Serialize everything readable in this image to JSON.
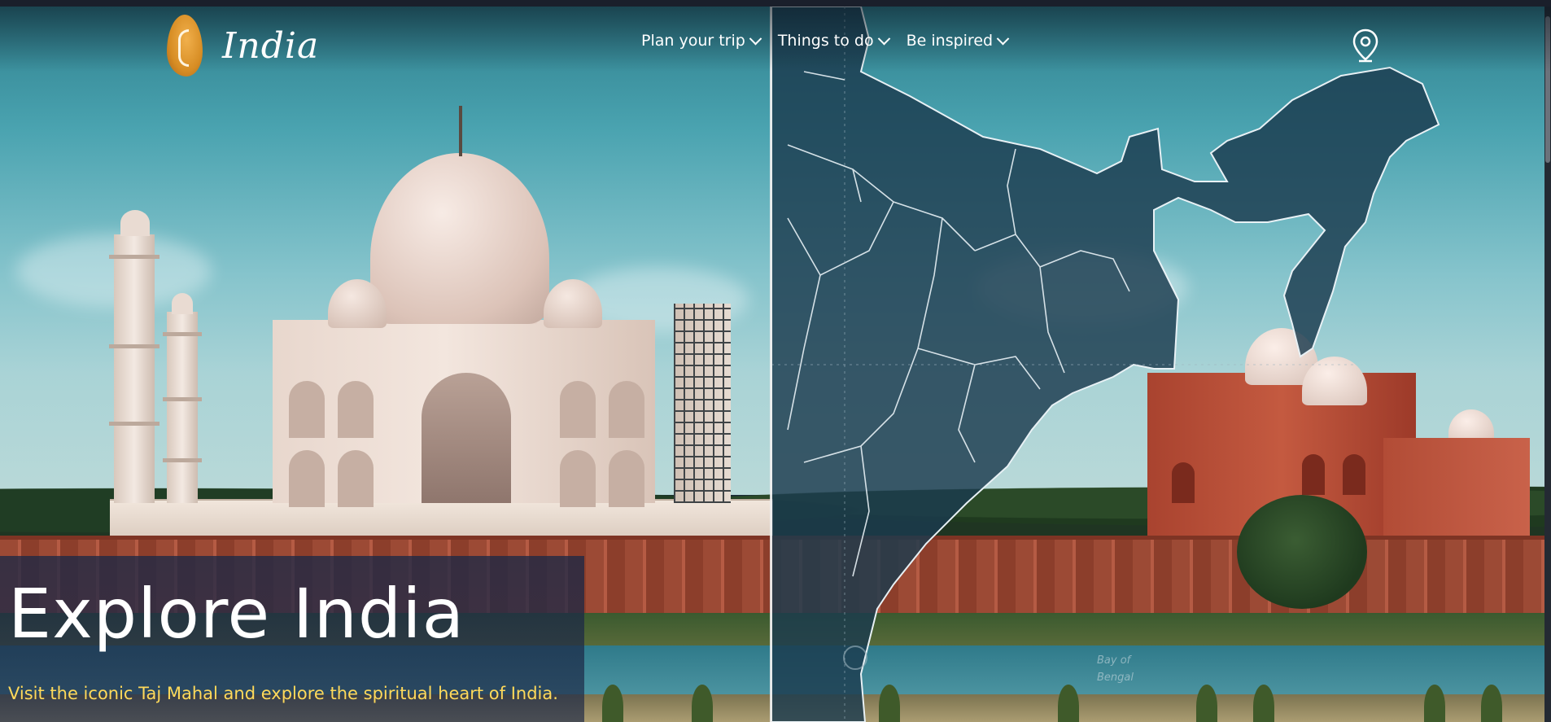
{
  "brand": {
    "name": "India",
    "logo_icon": "conch-shell-icon"
  },
  "nav": {
    "items": [
      {
        "label": "Plan your trip",
        "icon": "chevron-down-icon"
      },
      {
        "label": "Things to do",
        "icon": "chevron-down-icon"
      },
      {
        "label": "Be inspired",
        "icon": "chevron-down-icon"
      }
    ],
    "location_icon": "map-pin-icon"
  },
  "hero": {
    "title": "Explore India",
    "subtitle": "Visit the iconic Taj Mahal and explore the spiritual heart of India.",
    "subtitle_color": "#ffd95a"
  },
  "map": {
    "label_line1": "Bay of",
    "label_line2": "Bengal"
  },
  "colors": {
    "map_fill": "#1b3b4e",
    "panel": "#1c2846",
    "accent": "#ffd95a"
  }
}
